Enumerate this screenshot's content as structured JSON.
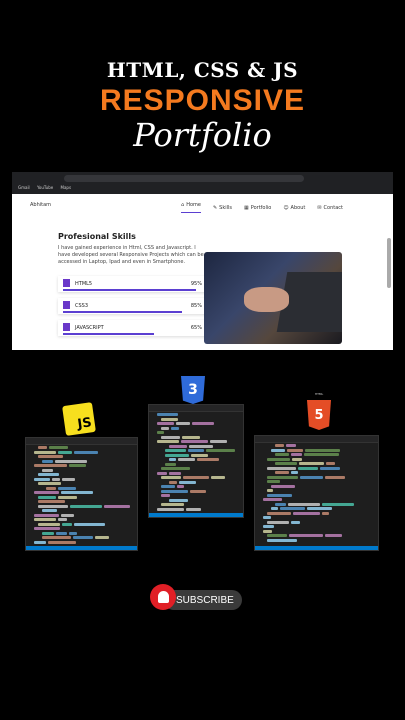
{
  "headline": {
    "line1": "HTML, CSS & JS",
    "line2": "RESPONSIVE",
    "line3": "Portfolio"
  },
  "colors": {
    "accent_orange": "#f47a1f",
    "accent_purple": "#5b3fd1",
    "subscribe_red": "#e01f26"
  },
  "browser": {
    "bookmarks": [
      "Gmail",
      "YouTube",
      "Maps"
    ],
    "brand": "Abhitam",
    "nav": [
      {
        "label": "Home",
        "icon": "home-icon"
      },
      {
        "label": "Skills",
        "icon": "pencil-icon"
      },
      {
        "label": "Portfolio",
        "icon": "grid-icon"
      },
      {
        "label": "About",
        "icon": "user-icon"
      },
      {
        "label": "Contact",
        "icon": "chat-icon"
      }
    ],
    "skills_title": "Profesional Skills",
    "skills_desc": "I have gained experience in Html, CSS and Javascript. I have developed several Responsive Projects which can be accessed in Laptop, Ipad and even in Smartphone.",
    "skills": [
      {
        "name": "HTML5",
        "pct": "95%",
        "level": 0.95
      },
      {
        "name": "CSS3",
        "pct": "85%",
        "level": 0.85
      },
      {
        "name": "JAVASCRIPT",
        "pct": "65%",
        "level": 0.65
      }
    ]
  },
  "badges": {
    "js": "JS",
    "css": "3",
    "html": "5",
    "html_caption": "HTML"
  },
  "subscribe": {
    "label": "SUBSCRIBE"
  }
}
